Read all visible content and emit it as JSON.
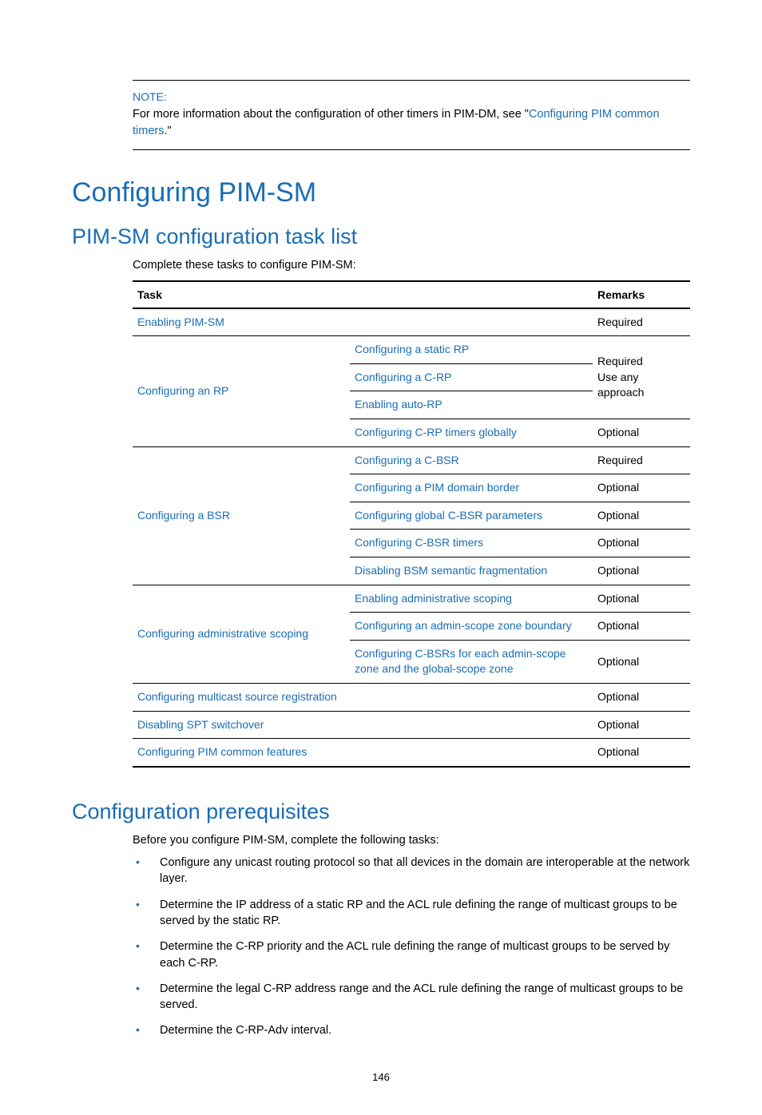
{
  "note": {
    "label": "NOTE:",
    "text_before": "For more information about the configuration of other timers in PIM-DM, see \"",
    "link": "Configuring PIM common timers",
    "text_after": ".\""
  },
  "h1": "Configuring PIM-SM",
  "h2_tasklist": "PIM-SM configuration task list",
  "tasklist_intro": "Complete these tasks to configure PIM-SM:",
  "table": {
    "header_task": "Task",
    "header_remarks": "Remarks",
    "row1": {
      "task": "Enabling PIM-SM",
      "remark": "Required"
    },
    "groupRP": {
      "label": "Configuring an RP",
      "sub1": "Configuring a static RP",
      "sub2": "Configuring a C-RP",
      "sub3": "Enabling auto-RP",
      "remark123": "Required\nUse any approach",
      "sub4": "Configuring C-RP timers globally",
      "remark4": "Optional"
    },
    "groupBSR": {
      "label": "Configuring a BSR",
      "sub1": "Configuring a C-BSR",
      "r1": "Required",
      "sub2": "Configuring a PIM domain border",
      "r2": "Optional",
      "sub3": "Configuring global C-BSR parameters",
      "r3": "Optional",
      "sub4": "Configuring C-BSR timers",
      "r4": "Optional",
      "sub5": "Disabling BSM semantic fragmentation",
      "r5": "Optional"
    },
    "groupAdmin": {
      "label": "Configuring administrative scoping",
      "sub1": "Enabling administrative scoping",
      "r1": "Optional",
      "sub2": "Configuring an admin-scope zone boundary",
      "r2": "Optional",
      "sub3": "Configuring C-BSRs for each admin-scope zone and the global-scope zone",
      "r3": "Optional"
    },
    "rowMSR": {
      "task": "Configuring multicast source registration",
      "remark": "Optional"
    },
    "rowSPT": {
      "task": "Disabling SPT switchover",
      "remark": "Optional"
    },
    "rowCommon": {
      "task": "Configuring PIM common features",
      "remark": "Optional"
    }
  },
  "h2_prereq": "Configuration prerequisites",
  "prereq_intro": "Before you configure PIM-SM, complete the following tasks:",
  "prereq_items": [
    "Configure any unicast routing protocol so that all devices in the domain are interoperable at the network layer.",
    "Determine the IP address of a static RP and the ACL rule defining the range of multicast groups to be served by the static RP.",
    "Determine the C-RP priority and the ACL rule defining the range of multicast groups to be served by each C-RP.",
    "Determine the legal C-RP address range and the ACL rule defining the range of multicast groups to be served.",
    "Determine the C-RP-Adv interval."
  ],
  "page_number": "146"
}
